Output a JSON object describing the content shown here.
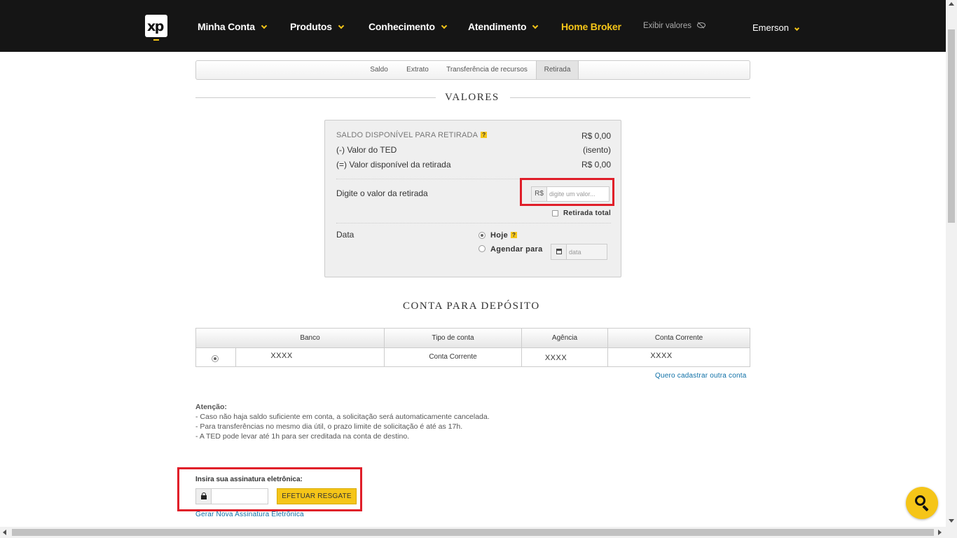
{
  "nav": {
    "logo": "xp",
    "items": [
      {
        "label": "Minha Conta"
      },
      {
        "label": "Produtos"
      },
      {
        "label": "Conhecimento"
      },
      {
        "label": "Atendimento"
      }
    ],
    "home_broker": "Home Broker",
    "exibir_valores": "Exibir valores",
    "user": "Emerson"
  },
  "tabs": [
    {
      "label": "Saldo"
    },
    {
      "label": "Extrato"
    },
    {
      "label": "Transferência de recursos"
    },
    {
      "label": "Retirada",
      "active": true
    }
  ],
  "valores": {
    "title": "VALORES",
    "saldo_label": "SALDO DISPONÍVEL PARA RETIRADA",
    "saldo_value": "R$ 0,00",
    "help": "?",
    "ted_label": "(-) Valor do TED",
    "ted_value": "(isento)",
    "disp_label": "(=) Valor disponível da retirada",
    "disp_value": "R$ 0,00",
    "digite_label": "Digite o valor da retirada",
    "currency_prefix": "R$",
    "valor_placeholder": "digite um valor...",
    "retirada_total": "Retirada total",
    "data_label": "Data",
    "hoje": "Hoje",
    "agendar": "Agendar para",
    "data_placeholder": "data"
  },
  "conta": {
    "title": "CONTA PARA DEPÓSITO",
    "headers": [
      "Banco",
      "Tipo de conta",
      "Agência",
      "Conta Corrente"
    ],
    "row": {
      "banco": "XXXX",
      "tipo": "Conta Corrente",
      "agencia": "XXXX",
      "conta": "XXXX"
    },
    "cadastrar_link": "Quero cadastrar outra conta"
  },
  "atencao": {
    "title": "Atenção:",
    "lines": [
      "- Caso não haja saldo suficiente em conta, a solicitação será automaticamente cancelada.",
      "- Para transferências no mesmo dia útil, o prazo limite de solicitação é até as 17h.",
      "- A TED pode levar até 1h para ser creditada na conta de destino."
    ]
  },
  "assinatura": {
    "label": "Insira sua assinatura eletrônica:",
    "button": "EFETUAR RESGATE",
    "gerar_link": "Gerar Nova Assinatura Eletrônica"
  },
  "colors": {
    "accent": "#f5c518",
    "highlight": "#e01e29",
    "link": "#0d6fa6",
    "nav_bg": "#151515"
  }
}
